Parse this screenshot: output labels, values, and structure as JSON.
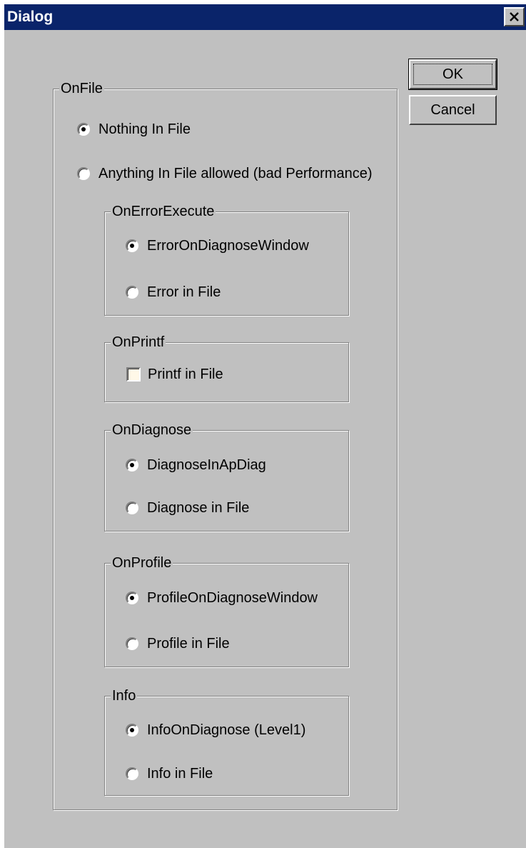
{
  "window": {
    "title": "Dialog"
  },
  "buttons": {
    "ok": "OK",
    "cancel": "Cancel"
  },
  "onfile": {
    "legend": "OnFile",
    "options": [
      {
        "label": "Nothing In File",
        "selected": true
      },
      {
        "label": "Anything In File allowed (bad Performance)",
        "selected": false
      }
    ]
  },
  "on_error_execute": {
    "legend": "OnErrorExecute",
    "options": [
      {
        "label": "ErrorOnDiagnoseWindow",
        "selected": true
      },
      {
        "label": "Error in File",
        "selected": false
      }
    ]
  },
  "on_printf": {
    "legend": "OnPrintf",
    "checkbox": {
      "label": "Printf in File",
      "checked": false
    }
  },
  "on_diagnose": {
    "legend": "OnDiagnose",
    "options": [
      {
        "label": "DiagnoseInApDiag",
        "selected": true
      },
      {
        "label": "Diagnose in File",
        "selected": false
      }
    ]
  },
  "on_profile": {
    "legend": "OnProfile",
    "options": [
      {
        "label": "ProfileOnDiagnoseWindow",
        "selected": true
      },
      {
        "label": "Profile in File",
        "selected": false
      }
    ]
  },
  "info": {
    "legend": "Info",
    "options": [
      {
        "label": "InfoOnDiagnose (Level1)",
        "selected": true
      },
      {
        "label": "Info in File",
        "selected": false
      }
    ]
  }
}
